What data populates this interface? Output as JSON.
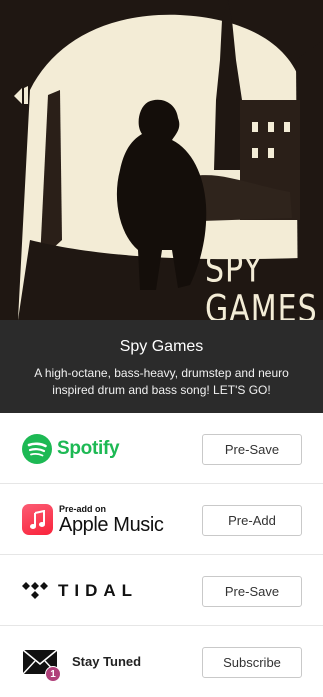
{
  "cover": {
    "art_text": "SPY GAMES",
    "palette": {
      "light": "#f3ecd6",
      "dark": "#1f1712"
    }
  },
  "release": {
    "title": "Spy Games",
    "description": "A high-octane, bass-heavy, drumstep and neuro inspired drum and bass song! LET'S GO!"
  },
  "services": [
    {
      "name": "Spotify",
      "icon": "spotify-icon",
      "button": "Pre-Save",
      "color": "#1db954"
    },
    {
      "name_small": "Pre-add on",
      "name": "Apple Music",
      "icon": "apple-music-icon",
      "button": "Pre-Add",
      "color": "#fa233b"
    },
    {
      "name": "TIDAL",
      "icon": "tidal-icon",
      "button": "Pre-Save",
      "color": "#111111"
    },
    {
      "name": "Stay Tuned",
      "icon": "envelope-icon",
      "badge": "1",
      "button": "Subscribe",
      "color": "#b0407a"
    }
  ]
}
